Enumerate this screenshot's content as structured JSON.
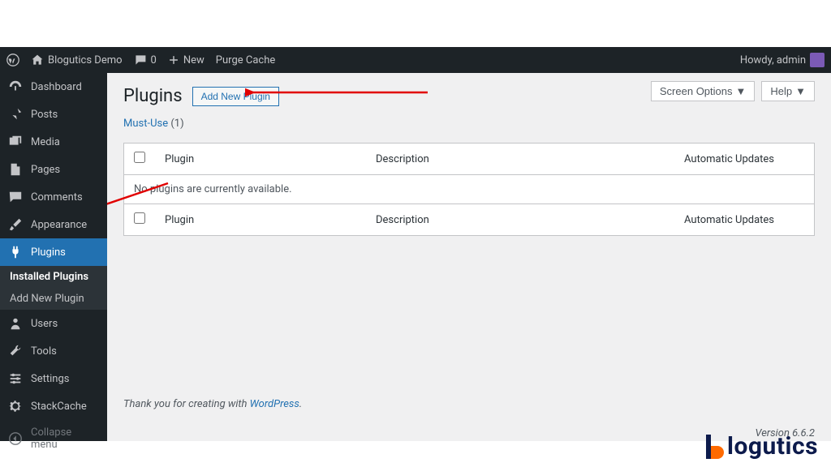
{
  "adminbar": {
    "site_name": "Blogutics Demo",
    "comment_count": "0",
    "new_label": "New",
    "purge_label": "Purge Cache",
    "howdy": "Howdy, admin"
  },
  "sidebar": {
    "items": [
      {
        "label": "Dashboard",
        "icon": "dashboard-icon"
      },
      {
        "label": "Posts",
        "icon": "pin-icon"
      },
      {
        "label": "Media",
        "icon": "media-icon"
      },
      {
        "label": "Pages",
        "icon": "page-icon"
      },
      {
        "label": "Comments",
        "icon": "comment-icon"
      },
      {
        "label": "Appearance",
        "icon": "brush-icon"
      },
      {
        "label": "Plugins",
        "icon": "plug-icon"
      },
      {
        "label": "Users",
        "icon": "users-icon"
      },
      {
        "label": "Tools",
        "icon": "tools-icon"
      },
      {
        "label": "Settings",
        "icon": "settings-icon"
      },
      {
        "label": "StackCache",
        "icon": "gear-icon"
      },
      {
        "label": "Collapse menu",
        "icon": "collapse-icon"
      }
    ],
    "submenu": [
      {
        "label": "Installed Plugins"
      },
      {
        "label": "Add New Plugin"
      }
    ]
  },
  "content": {
    "title": "Plugins",
    "add_new": "Add New Plugin",
    "screen_options": "Screen Options",
    "help": "Help",
    "filter_label": "Must-Use",
    "filter_count": "(1)",
    "table": {
      "col_plugin": "Plugin",
      "col_desc": "Description",
      "col_updates": "Automatic Updates",
      "no_items": "No plugins are currently available."
    },
    "footer_thank": "Thank you for creating with ",
    "footer_link": "WordPress",
    "version": "Version 6.6.2"
  },
  "brand": {
    "name": "logutics"
  }
}
